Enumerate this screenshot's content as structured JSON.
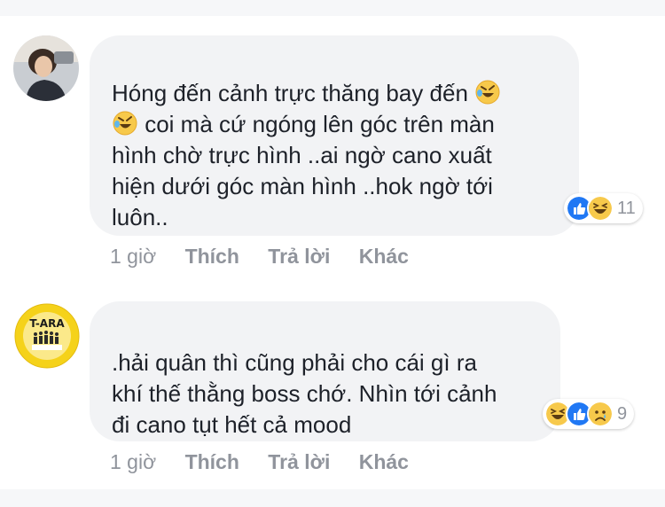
{
  "colors": {
    "bubble_bg": "#f2f3f5",
    "text": "#1d2129",
    "meta": "#90949c",
    "like_blue": "#2078f4",
    "haha_yellow": "#f7c94b"
  },
  "comments": [
    {
      "text_lines": [
        "Hóng đến cảnh trực thăng bay đến",
        " coi mà cứ ngóng lên góc trên màn",
        "hình chờ trực hình ..ai ngờ cano xuất",
        "hiện dưới góc màn hình ..hok ngờ tới",
        "luôn.."
      ],
      "inline_emojis": [
        "rofl-emoji",
        "rofl-emoji"
      ],
      "time": "1 giờ",
      "actions": [
        "Thích",
        "Trả lời",
        "Khác"
      ],
      "reactions": [
        "like-icon",
        "haha-icon"
      ],
      "reaction_count": "11"
    },
    {
      "avatar_text": "T-ARA",
      "text_lines": [
        ".hải quân thì cũng phải cho cái gì ra",
        "khí thế thằng boss chớ. Nhìn tới cảnh",
        "đi cano tụt hết cả mood"
      ],
      "time": "1 giờ",
      "actions": [
        "Thích",
        "Trả lời",
        "Khác"
      ],
      "reactions": [
        "haha-icon",
        "like-icon",
        "sad-icon"
      ],
      "reaction_count": "9"
    }
  ]
}
